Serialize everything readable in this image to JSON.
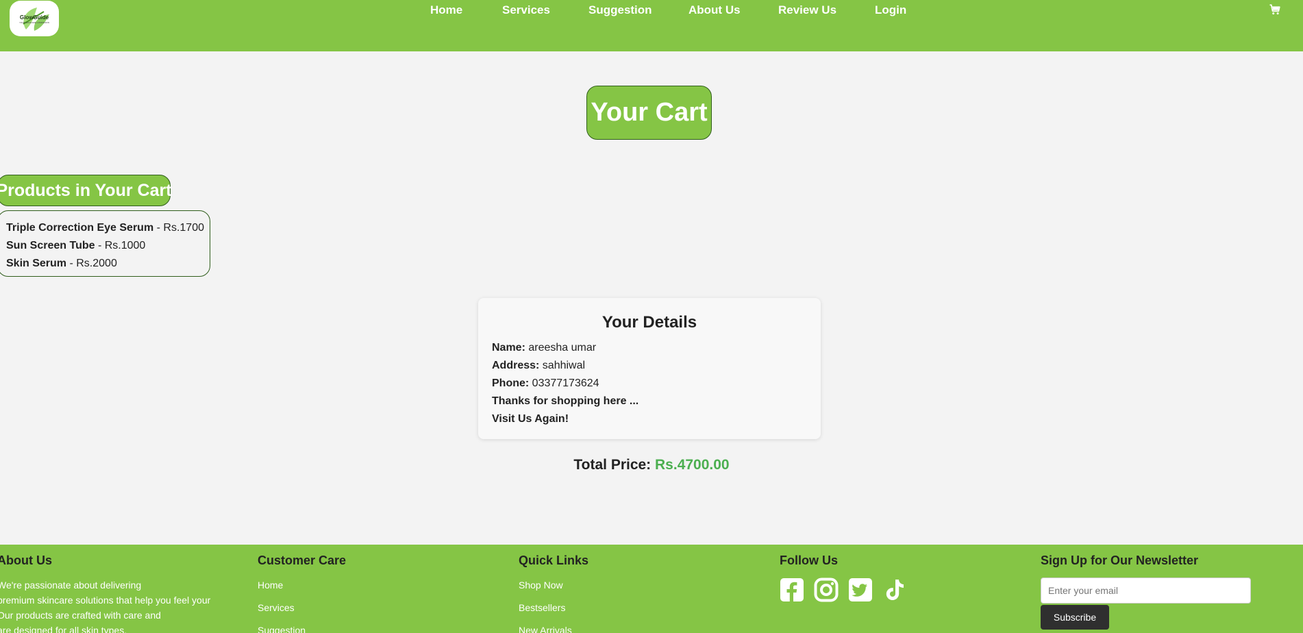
{
  "header": {
    "logo": {
      "text": "GlowGuide",
      "subtext": "YOUR SKINCARE COMPANION"
    },
    "nav": [
      {
        "label": "Home"
      },
      {
        "label": "Services"
      },
      {
        "label": "Suggestion"
      },
      {
        "label": "About Us"
      },
      {
        "label": "Review Us"
      },
      {
        "label": "Login"
      }
    ],
    "cart_icon": "cart-icon"
  },
  "main": {
    "page_title": "Your Cart",
    "products_title": "Products in Your Cart",
    "products": [
      {
        "name": "Triple Correction Eye Serum",
        "price": " - Rs.1700"
      },
      {
        "name": "Sun Screen Tube",
        "price": " - Rs.1000"
      },
      {
        "name": "Skin Serum",
        "price": " - Rs.2000"
      }
    ],
    "details": {
      "title": "Your Details",
      "name_label": "Name:",
      "name_value": " areesha umar",
      "address_label": "Address:",
      "address_value": " sahhiwal",
      "phone_label": "Phone:",
      "phone_value": " 03377173624",
      "thanks": "Thanks for shopping here ...",
      "visit_again": "Visit Us Again!"
    },
    "total": {
      "label": "Total Price: ",
      "amount": "Rs.4700.00"
    }
  },
  "footer": {
    "about": {
      "title": "About Us",
      "lines": [
        "We're passionate about delivering",
        "premium skincare solutions that help you feel your",
        "Our products are crafted with care and",
        "are designed for all skin types."
      ]
    },
    "customer_care": {
      "title": "Customer Care",
      "links": [
        "Home",
        "Services",
        "Suggestion"
      ]
    },
    "quick_links": {
      "title": "Quick Links",
      "links": [
        "Shop Now",
        "Bestsellers",
        "New Arrivals"
      ]
    },
    "follow": {
      "title": "Follow Us",
      "icons": [
        "facebook-icon",
        "instagram-icon",
        "twitter-icon",
        "tiktok-icon"
      ]
    },
    "newsletter": {
      "title": "Sign Up for Our Newsletter",
      "placeholder": "Enter your email",
      "button": "Subscribe"
    }
  },
  "colors": {
    "brand_green": "#85c545",
    "page_background": "#f3f3f3",
    "total_amount": "#4caf50",
    "subscribe_button": "#2f2f2f"
  }
}
